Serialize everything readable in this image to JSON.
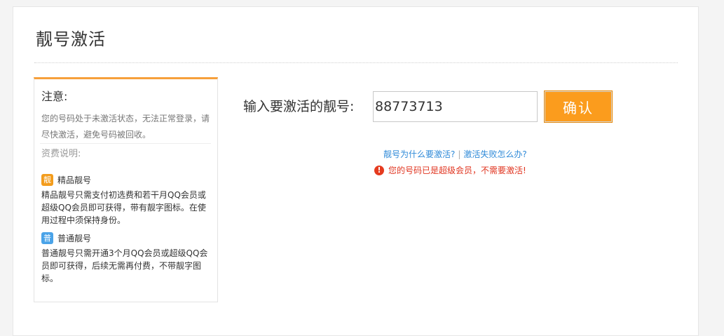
{
  "page": {
    "title": "靓号激活"
  },
  "sidebar": {
    "notice_title": "注意:",
    "notice_text": "您的号码处于未激活状态，无法正常登录，请尽快激活，避免号码被回收。",
    "fee_title": "资费说明:",
    "premium": {
      "badge": "靓",
      "label": "精品靓号",
      "description": "精品靓号只需支付初选费和若干月QQ会员或超级QQ会员即可获得，带有靓字图标。在使用过程中须保持身份。"
    },
    "normal": {
      "badge": "普",
      "label": "普通靓号",
      "description": "普通靓号只需开通3个月QQ会员或超级QQ会员即可获得，后续无需再付费，不带靓字图标。"
    }
  },
  "form": {
    "label": "输入要激活的靓号:",
    "input_value": "88773713",
    "confirm_label": "确认"
  },
  "help": {
    "why_link": "靓号为什么要激活?",
    "separator": "|",
    "fail_link": "激活失败怎么办?"
  },
  "error": {
    "icon": "!",
    "message": "您的号码已是超级会员，不需要激活!"
  },
  "colors": {
    "accent": "#fb9c1d",
    "link": "#2f8ad8",
    "error": "#e0341f"
  }
}
